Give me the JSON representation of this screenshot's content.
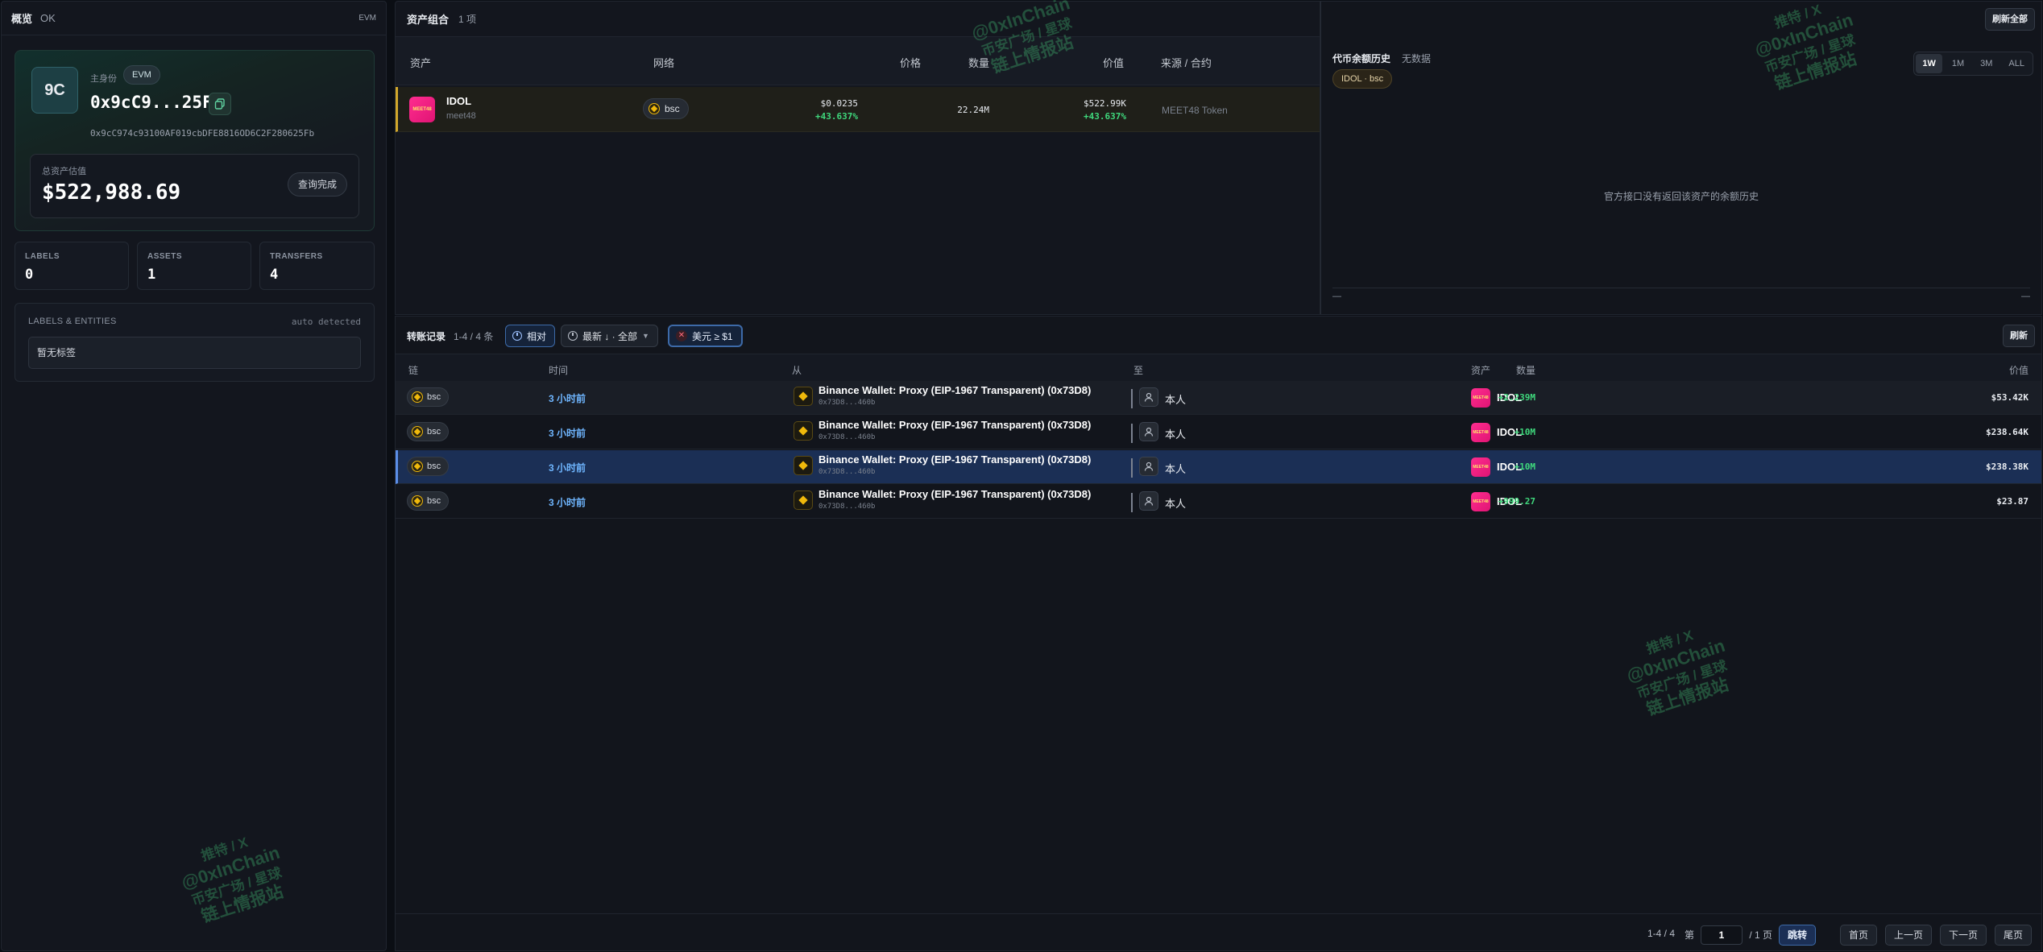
{
  "left": {
    "title": "概览",
    "status": "OK",
    "chain_tag": "EVM",
    "identity": {
      "avatar": "9C",
      "role_label": "主身份",
      "badge": "EVM",
      "short_address": "0x9cC9...25Fb",
      "full_address": "0x9cC974c93100AF019cbDFE8816OD6C2F280625Fb"
    },
    "total": {
      "label": "总资产估值",
      "value": "$522,988.69",
      "button": "查询完成"
    },
    "stats": [
      {
        "label": "LABELS",
        "value": "0"
      },
      {
        "label": "ASSETS",
        "value": "1"
      },
      {
        "label": "TRANSFERS",
        "value": "4"
      }
    ],
    "labels_box": {
      "title": "LABELS & ENTITIES",
      "hint": "auto detected",
      "empty": "暂无标签"
    }
  },
  "assets": {
    "title": "资产组合",
    "count": "1 项",
    "columns": [
      "资产",
      "网络",
      "价格",
      "数量",
      "价值",
      "来源 / 合约"
    ],
    "rows": [
      {
        "symbol": "IDOL",
        "sub": "meet48",
        "icon_text": "MEET48",
        "network": "bsc",
        "price": "$0.0235",
        "price_change": "+43.637%",
        "quantity": "22.24M",
        "value": "$522.99K",
        "value_change": "+43.637%",
        "source": "MEET48 Token"
      }
    ]
  },
  "history": {
    "refresh_all": "刷新全部",
    "title": "代币余额历史",
    "subtitle": "无数据",
    "tag": "IDOL · bsc",
    "ranges": [
      "1W",
      "1M",
      "3M",
      "ALL"
    ],
    "active_range": "1W",
    "empty_message": "官方接口没有返回该资产的余额历史",
    "axis_left": "—",
    "axis_right": "—"
  },
  "transfers": {
    "title": "转账记录",
    "count": "1-4 / 4 条",
    "chip_relative": "相对",
    "chip_sort": "最新 ↓ · 全部",
    "chip_filter": "美元 ≥ $1",
    "refresh": "刷新",
    "columns": [
      "链",
      "时间",
      "从",
      "至",
      "资产",
      "数量",
      "价值"
    ],
    "rows": [
      {
        "chain": "bsc",
        "time": "3 小时前",
        "from": "Binance Wallet: Proxy (EIP-1967 Transparent) (0x73D8)",
        "from_addr": "0x73D8...460b",
        "to": "本人",
        "asset": "IDOL",
        "qty": "+2.239M",
        "value": "$53.42K"
      },
      {
        "chain": "bsc",
        "time": "3 小时前",
        "from": "Binance Wallet: Proxy (EIP-1967 Transparent) (0x73D8)",
        "from_addr": "0x73D8...460b",
        "to": "本人",
        "asset": "IDOL",
        "qty": "+10M",
        "value": "$238.64K"
      },
      {
        "chain": "bsc",
        "time": "3 小时前",
        "from": "Binance Wallet: Proxy (EIP-1967 Transparent) (0x73D8)",
        "from_addr": "0x73D8...460b",
        "to": "本人",
        "asset": "IDOL",
        "qty": "+10M",
        "value": "$238.38K"
      },
      {
        "chain": "bsc",
        "time": "3 小时前",
        "from": "Binance Wallet: Proxy (EIP-1967 Transparent) (0x73D8)",
        "from_addr": "0x73D8...460b",
        "to": "本人",
        "asset": "IDOL",
        "qty": "+999.27",
        "value": "$23.87"
      }
    ],
    "pager": {
      "range": "1-4 / 4",
      "page_prefix": "第",
      "page_value": "1",
      "page_suffix": "/ 1 页",
      "jump": "跳转",
      "first": "首页",
      "prev": "上一页",
      "next": "下一页",
      "last": "尾页"
    }
  },
  "watermark": {
    "line1": "推特 / X",
    "line2": "@0xInChain",
    "line3": "币安广场 / 星球",
    "line4": "链上情报站"
  },
  "colors": {
    "accent_green": "#3fd87c",
    "accent_blue": "#6fb6ff",
    "bnb_yellow": "#f0b90b",
    "token_pink": "#ff2d8f"
  }
}
